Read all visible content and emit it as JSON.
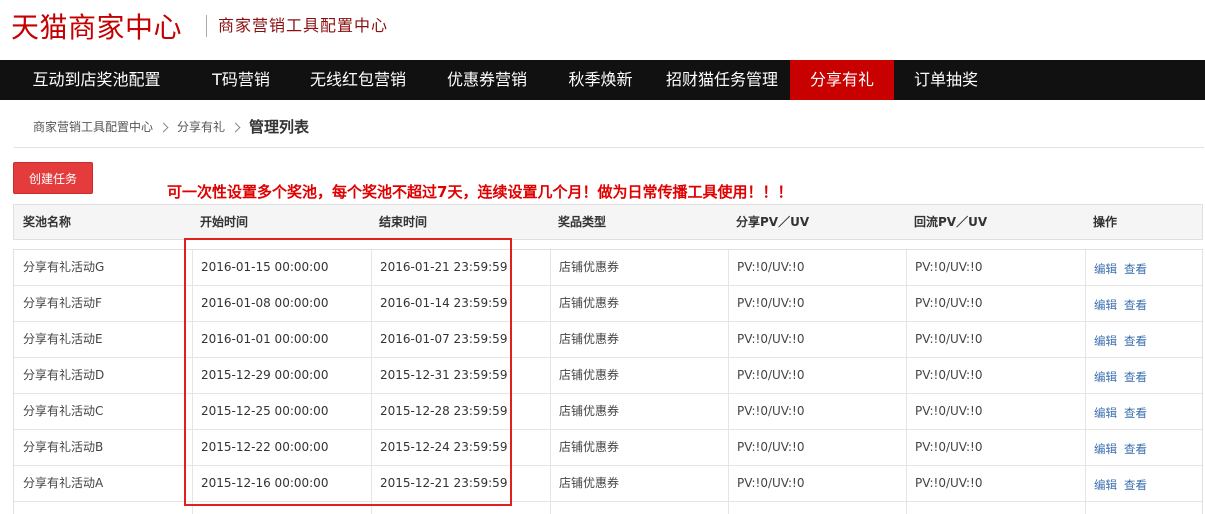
{
  "header": {
    "logo_text": "天猫商家中心",
    "subtitle": "商家营销工具配置中心"
  },
  "nav": {
    "items": [
      {
        "label": "互动到店奖池配置",
        "active": false
      },
      {
        "label": "T码营销",
        "active": false
      },
      {
        "label": "无线红包营销",
        "active": false
      },
      {
        "label": "优惠券营销",
        "active": false
      },
      {
        "label": "秋季焕新",
        "active": false
      },
      {
        "label": "招财猫任务管理",
        "active": false
      },
      {
        "label": "分享有礼",
        "active": true
      },
      {
        "label": "订单抽奖",
        "active": false
      }
    ]
  },
  "breadcrumb": {
    "items": [
      "商家营销工具配置中心",
      "分享有礼"
    ],
    "current": "管理列表"
  },
  "toolbar": {
    "create_label": "创建任务"
  },
  "annotation": "可一次性设置多个奖池，每个奖池不超过7天，连续设置几个月！做为日常传播工具使用！！！",
  "table": {
    "columns": [
      "奖池名称",
      "开始时间",
      "结束时间",
      "奖品类型",
      "分享PV／UV",
      "回流PV／UV",
      "操作"
    ],
    "rows": [
      {
        "name": "分享有礼活动G",
        "start": "2016-01-15 00:00:00",
        "end": "2016-01-21 23:59:59",
        "prize": "店铺优惠券",
        "share": "PV:!0/UV:!0",
        "back": "PV:!0/UV:!0"
      },
      {
        "name": "分享有礼活动F",
        "start": "2016-01-08 00:00:00",
        "end": "2016-01-14 23:59:59",
        "prize": "店铺优惠券",
        "share": "PV:!0/UV:!0",
        "back": "PV:!0/UV:!0"
      },
      {
        "name": "分享有礼活动E",
        "start": "2016-01-01 00:00:00",
        "end": "2016-01-07 23:59:59",
        "prize": "店铺优惠券",
        "share": "PV:!0/UV:!0",
        "back": "PV:!0/UV:!0"
      },
      {
        "name": "分享有礼活动D",
        "start": "2015-12-29 00:00:00",
        "end": "2015-12-31 23:59:59",
        "prize": "店铺优惠券",
        "share": "PV:!0/UV:!0",
        "back": "PV:!0/UV:!0"
      },
      {
        "name": "分享有礼活动C",
        "start": "2015-12-25 00:00:00",
        "end": "2015-12-28 23:59:59",
        "prize": "店铺优惠券",
        "share": "PV:!0/UV:!0",
        "back": "PV:!0/UV:!0"
      },
      {
        "name": "分享有礼活动B",
        "start": "2015-12-22 00:00:00",
        "end": "2015-12-24 23:59:59",
        "prize": "店铺优惠券",
        "share": "PV:!0/UV:!0",
        "back": "PV:!0/UV:!0"
      },
      {
        "name": "分享有礼活动A",
        "start": "2015-12-16 00:00:00",
        "end": "2015-12-21 23:59:59",
        "prize": "店铺优惠券",
        "share": "PV:!0/UV:!0",
        "back": "PV:!0/UV:!0"
      }
    ],
    "edit_label": "编辑",
    "view_label": "查看"
  },
  "colors": {
    "brand_red": "#c40000",
    "nav_bg": "#111111",
    "nav_active": "#c80000",
    "button_red": "#e43c3c",
    "annotation_red": "#e00000",
    "link_blue": "#3a6fb0"
  }
}
